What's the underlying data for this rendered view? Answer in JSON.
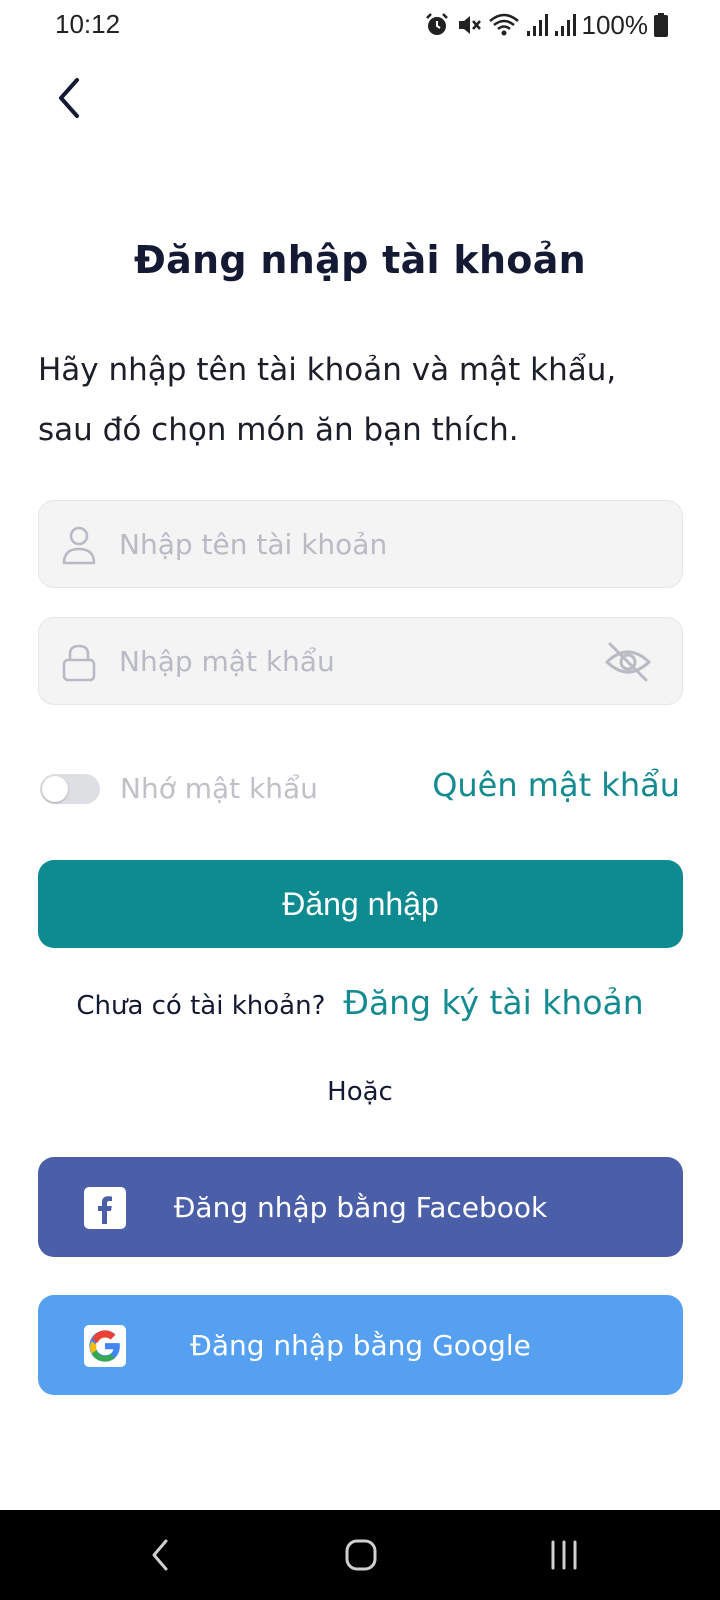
{
  "status_bar": {
    "time": "10:12",
    "battery": "100%",
    "icons": [
      "alarm-icon",
      "mute-icon",
      "wifi-icon",
      "signal-icon",
      "signal-icon",
      "battery-icon"
    ]
  },
  "header": {
    "back_icon": "chevron-left-icon",
    "title": "Đăng nhập tài khoản"
  },
  "intro": {
    "line1": "Hãy nhập tên tài khoản và mật khẩu,",
    "line2": "sau đó chọn món ăn bạn thích."
  },
  "form": {
    "username": {
      "placeholder": "Nhập tên tài khoản",
      "value": "",
      "icon": "user-icon"
    },
    "password": {
      "placeholder": "Nhập mật khẩu",
      "value": "",
      "icon": "lock-icon",
      "toggle_icon": "eye-off-icon"
    },
    "remember": {
      "label": "Nhớ mật khẩu",
      "checked": false
    },
    "forgot_label": "Quên mật khẩu",
    "submit_label": "Đăng nhập"
  },
  "signup": {
    "prompt": "Chưa có tài khoản?",
    "link": "Đăng ký tài khoản"
  },
  "divider_text": "Hoặc",
  "social": {
    "facebook_label": "Đăng nhập bằng Facebook",
    "google_label": "Đăng nhập bằng Google"
  },
  "colors": {
    "primary": "#0e8a91",
    "link": "#138b90",
    "facebook": "#4b5fa8",
    "google": "#55a0f1",
    "title": "#141a33"
  },
  "nav_bar": {
    "buttons": [
      "back-nav-icon",
      "home-nav-icon",
      "recents-nav-icon"
    ]
  }
}
